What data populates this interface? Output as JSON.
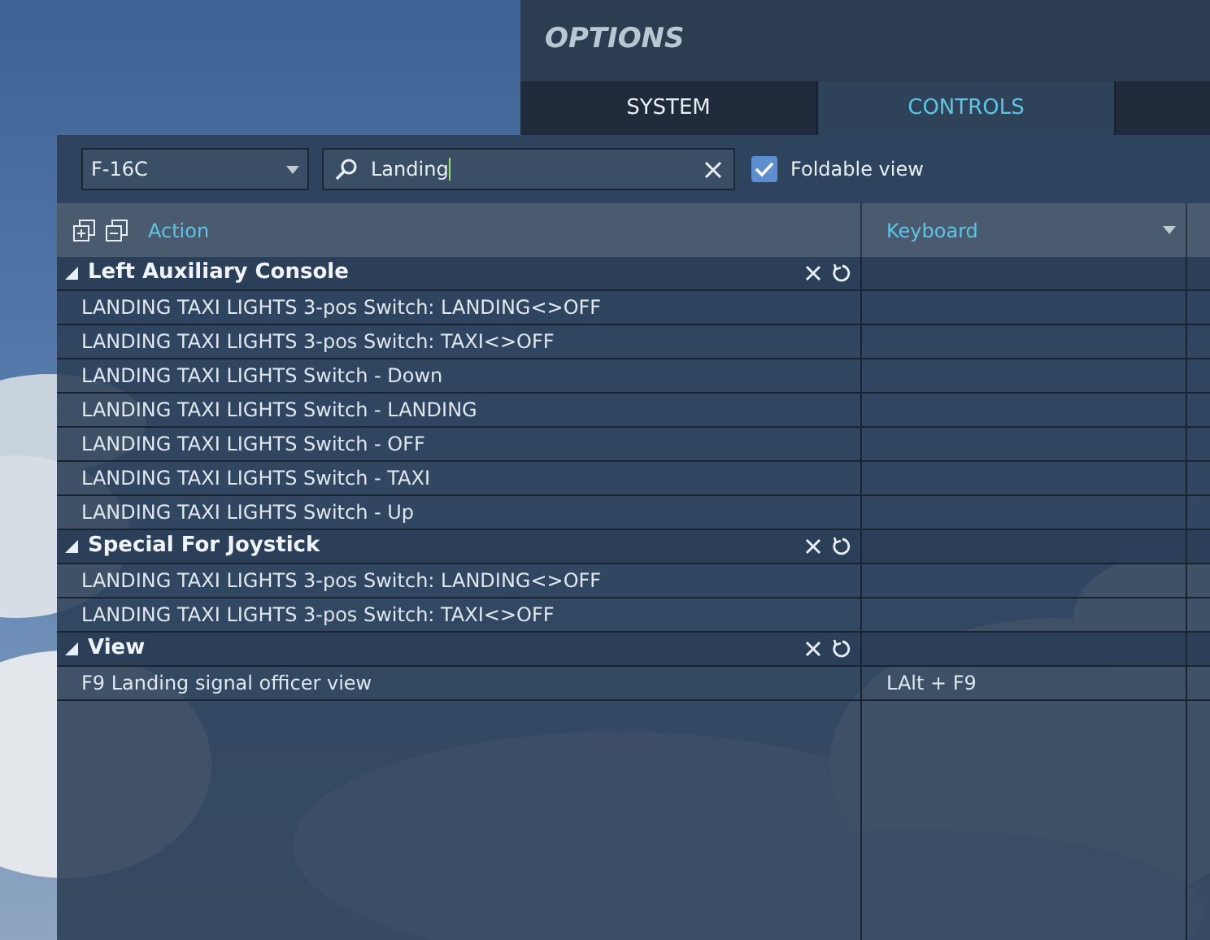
{
  "header": {
    "title": "OPTIONS"
  },
  "tabs": [
    {
      "label": "SYSTEM",
      "selected": false
    },
    {
      "label": "CONTROLS",
      "selected": true
    }
  ],
  "toolbar": {
    "aircraft": "F-16C",
    "search": {
      "value": "Landing"
    },
    "foldable": {
      "label": "Foldable view",
      "checked": true
    }
  },
  "table": {
    "columns": [
      {
        "label": "Action"
      },
      {
        "label": "Keyboard"
      }
    ],
    "groups": [
      {
        "title": "Left Auxiliary Console",
        "expanded": true,
        "rows": [
          {
            "action": "LANDING TAXI LIGHTS 3-pos Switch: LANDING<>OFF"
          },
          {
            "action": "LANDING TAXI LIGHTS 3-pos Switch: TAXI<>OFF"
          },
          {
            "action": "LANDING TAXI LIGHTS Switch - Down"
          },
          {
            "action": "LANDING TAXI LIGHTS Switch - LANDING"
          },
          {
            "action": "LANDING TAXI LIGHTS Switch - OFF"
          },
          {
            "action": "LANDING TAXI LIGHTS Switch - TAXI"
          },
          {
            "action": "LANDING TAXI LIGHTS Switch - Up"
          }
        ]
      },
      {
        "title": "Special For Joystick",
        "expanded": true,
        "rows": [
          {
            "action": "LANDING TAXI LIGHTS 3-pos Switch: LANDING<>OFF"
          },
          {
            "action": "LANDING TAXI LIGHTS 3-pos Switch: TAXI<>OFF"
          }
        ]
      },
      {
        "title": "View",
        "expanded": true,
        "rows": [
          {
            "action": "F9 Landing signal officer view",
            "keyboard": "LAlt + F9"
          }
        ]
      }
    ]
  }
}
